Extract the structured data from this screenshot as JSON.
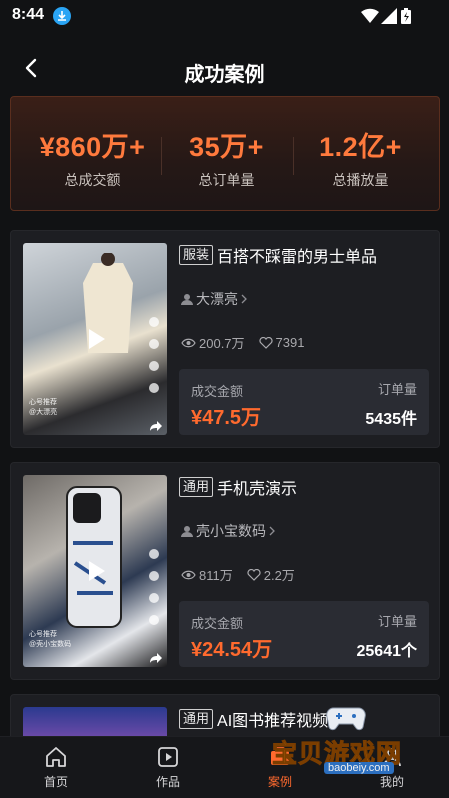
{
  "status_bar": {
    "time": "8:44",
    "icons": [
      "download-icon",
      "wifi-icon",
      "signal-icon",
      "battery-icon"
    ]
  },
  "nav": {
    "title": "成功案例",
    "back_icon": "chevron-left-icon"
  },
  "stats": [
    {
      "value": "¥860万+",
      "label": "总成交额"
    },
    {
      "value": "35万+",
      "label": "总订单量"
    },
    {
      "value": "1.2亿+",
      "label": "总播放量"
    }
  ],
  "cases": [
    {
      "tag": "服装",
      "title": "百搭不踩雷的男士单品",
      "author": "大漂亮",
      "views": "200.7万",
      "likes": "7391",
      "deal_label": "成交金额",
      "deal_amount": "¥47.5万",
      "order_label": "订单量",
      "order_count": "5435件",
      "thumb_caption": "心号推荐",
      "thumb_user": "@大漂亮"
    },
    {
      "tag": "通用",
      "title": "手机壳演示",
      "author": "壳小宝数码",
      "views": "811万",
      "likes": "2.2万",
      "deal_label": "成交金额",
      "deal_amount": "¥24.54万",
      "order_label": "订单量",
      "order_count": "25641个",
      "thumb_caption": "心号推荐",
      "thumb_user": "@壳小宝数码"
    },
    {
      "tag": "通用",
      "title": "AI图书推荐视频"
    }
  ],
  "tabs": [
    {
      "label": "首页",
      "icon": "home-icon"
    },
    {
      "label": "作品",
      "icon": "video-icon"
    },
    {
      "label": "案例",
      "icon": "case-icon",
      "active": true
    },
    {
      "label": "我的",
      "icon": "user-icon"
    }
  ],
  "watermark": {
    "text": "宝贝游戏网",
    "url": "baobeiy.com"
  },
  "colors": {
    "accent": "#ff6a2e",
    "stat_value": "#ff7a3d",
    "background": "#111214",
    "card": "#1d1e22"
  }
}
